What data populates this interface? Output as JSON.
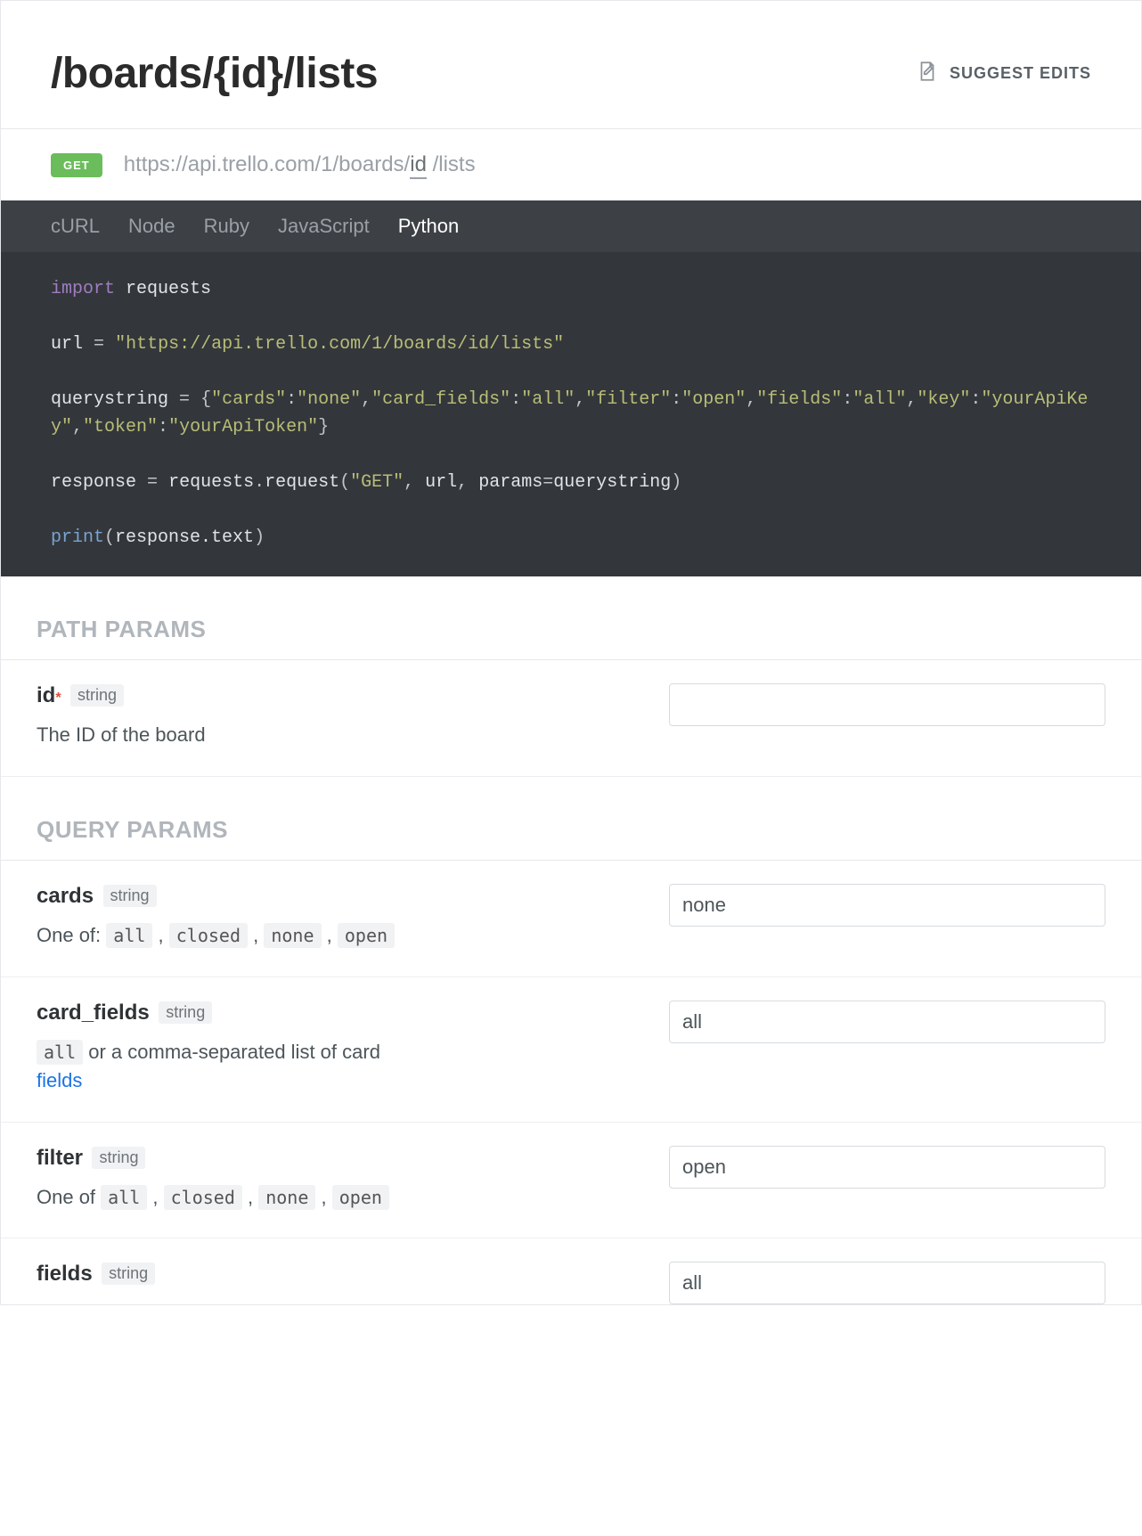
{
  "header": {
    "title": "/boards/{id}/lists",
    "suggest_label": "SUGGEST EDITS"
  },
  "endpoint": {
    "method": "GET",
    "url_prefix": "https://api.trello.com/1/boards/",
    "url_param": "id",
    "url_suffix": "/lists"
  },
  "code_tabs": {
    "items": [
      "cURL",
      "Node",
      "Ruby",
      "JavaScript",
      "Python"
    ],
    "active": 4
  },
  "code_block": {
    "import_kw": "import",
    "import_mod": "requests",
    "url_var": "url",
    "eq": "=",
    "url_str": "\"https://api.trello.com/1/boards/id/lists\"",
    "qs_var": "querystring",
    "qs_open": "{",
    "qs_k1": "\"cards\"",
    "qs_v1": "\"none\"",
    "qs_k2": "\"card_fields\"",
    "qs_v2": "\"all\"",
    "qs_k3": "\"filter\"",
    "qs_v3": "\"open\"",
    "qs_k4": "\"fields\"",
    "qs_v4": "\"all\"",
    "qs_k5": "\"key\"",
    "qs_v5": "\"yourApiKey\"",
    "qs_k6": "\"token\"",
    "qs_v6": "\"yourApiToken\"",
    "qs_close": "}",
    "resp_var": "response",
    "req_obj": "requests",
    "req_fn": "request",
    "method_str": "\"GET\"",
    "params_kw": "params",
    "print_fn": "print",
    "resp_text": "response.text"
  },
  "sections": {
    "path_title": "PATH PARAMS",
    "query_title": "QUERY PARAMS"
  },
  "path_params": [
    {
      "name": "id",
      "required": true,
      "type": "string",
      "desc": "The ID of the board",
      "value": ""
    }
  ],
  "query_params": [
    {
      "name": "cards",
      "type": "string",
      "value": "none",
      "desc_plain": "One of: ",
      "chips": [
        "all",
        "closed",
        "none",
        "open"
      ]
    },
    {
      "name": "card_fields",
      "type": "string",
      "value": "all",
      "lead_chip": "all",
      "desc_plain": " or a comma-separated list of card ",
      "link_text": "fields"
    },
    {
      "name": "filter",
      "type": "string",
      "value": "open",
      "desc_plain": "One of ",
      "chips": [
        "all",
        "closed",
        "none",
        "open"
      ]
    },
    {
      "name": "fields",
      "type": "string",
      "value": "all"
    }
  ]
}
